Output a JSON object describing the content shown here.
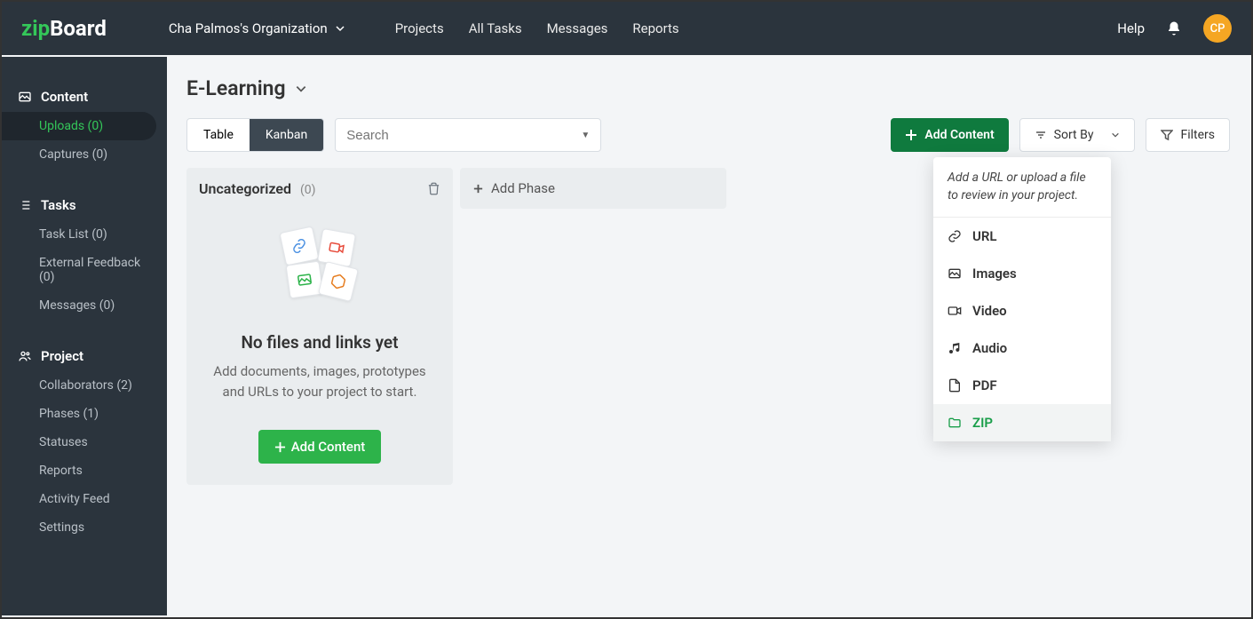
{
  "logo": {
    "zip": "zip",
    "board": "Board"
  },
  "org": {
    "name": "Cha Palmos's Organization"
  },
  "topnav": {
    "projects": "Projects",
    "all_tasks": "All Tasks",
    "messages": "Messages",
    "reports": "Reports"
  },
  "topright": {
    "help": "Help",
    "avatar": "CP"
  },
  "sidebar": {
    "content": {
      "heading": "Content",
      "uploads": "Uploads (0)",
      "captures": "Captures (0)"
    },
    "tasks": {
      "heading": "Tasks",
      "task_list": "Task List (0)",
      "external_feedback": "External Feedback (0)",
      "messages": "Messages (0)"
    },
    "project": {
      "heading": "Project",
      "collaborators": "Collaborators (2)",
      "phases": "Phases (1)",
      "statuses": "Statuses",
      "reports": "Reports",
      "activity": "Activity Feed",
      "settings": "Settings"
    }
  },
  "page": {
    "title": "E-Learning"
  },
  "view_tabs": {
    "table": "Table",
    "kanban": "Kanban"
  },
  "search": {
    "placeholder": "Search"
  },
  "buttons": {
    "add_content": "Add Content",
    "sort_by": "Sort By",
    "filters": "Filters",
    "add_phase": "Add Phase",
    "add_content_small": "Add Content"
  },
  "column": {
    "title": "Uncategorized",
    "count": "(0)"
  },
  "empty": {
    "title": "No files and links yet",
    "desc": "Add documents, images, prototypes and URLs to your project to start."
  },
  "dropdown": {
    "header": "Add a URL or upload a file to review in your project.",
    "url": "URL",
    "images": "Images",
    "video": "Video",
    "audio": "Audio",
    "pdf": "PDF",
    "zip": "ZIP"
  }
}
